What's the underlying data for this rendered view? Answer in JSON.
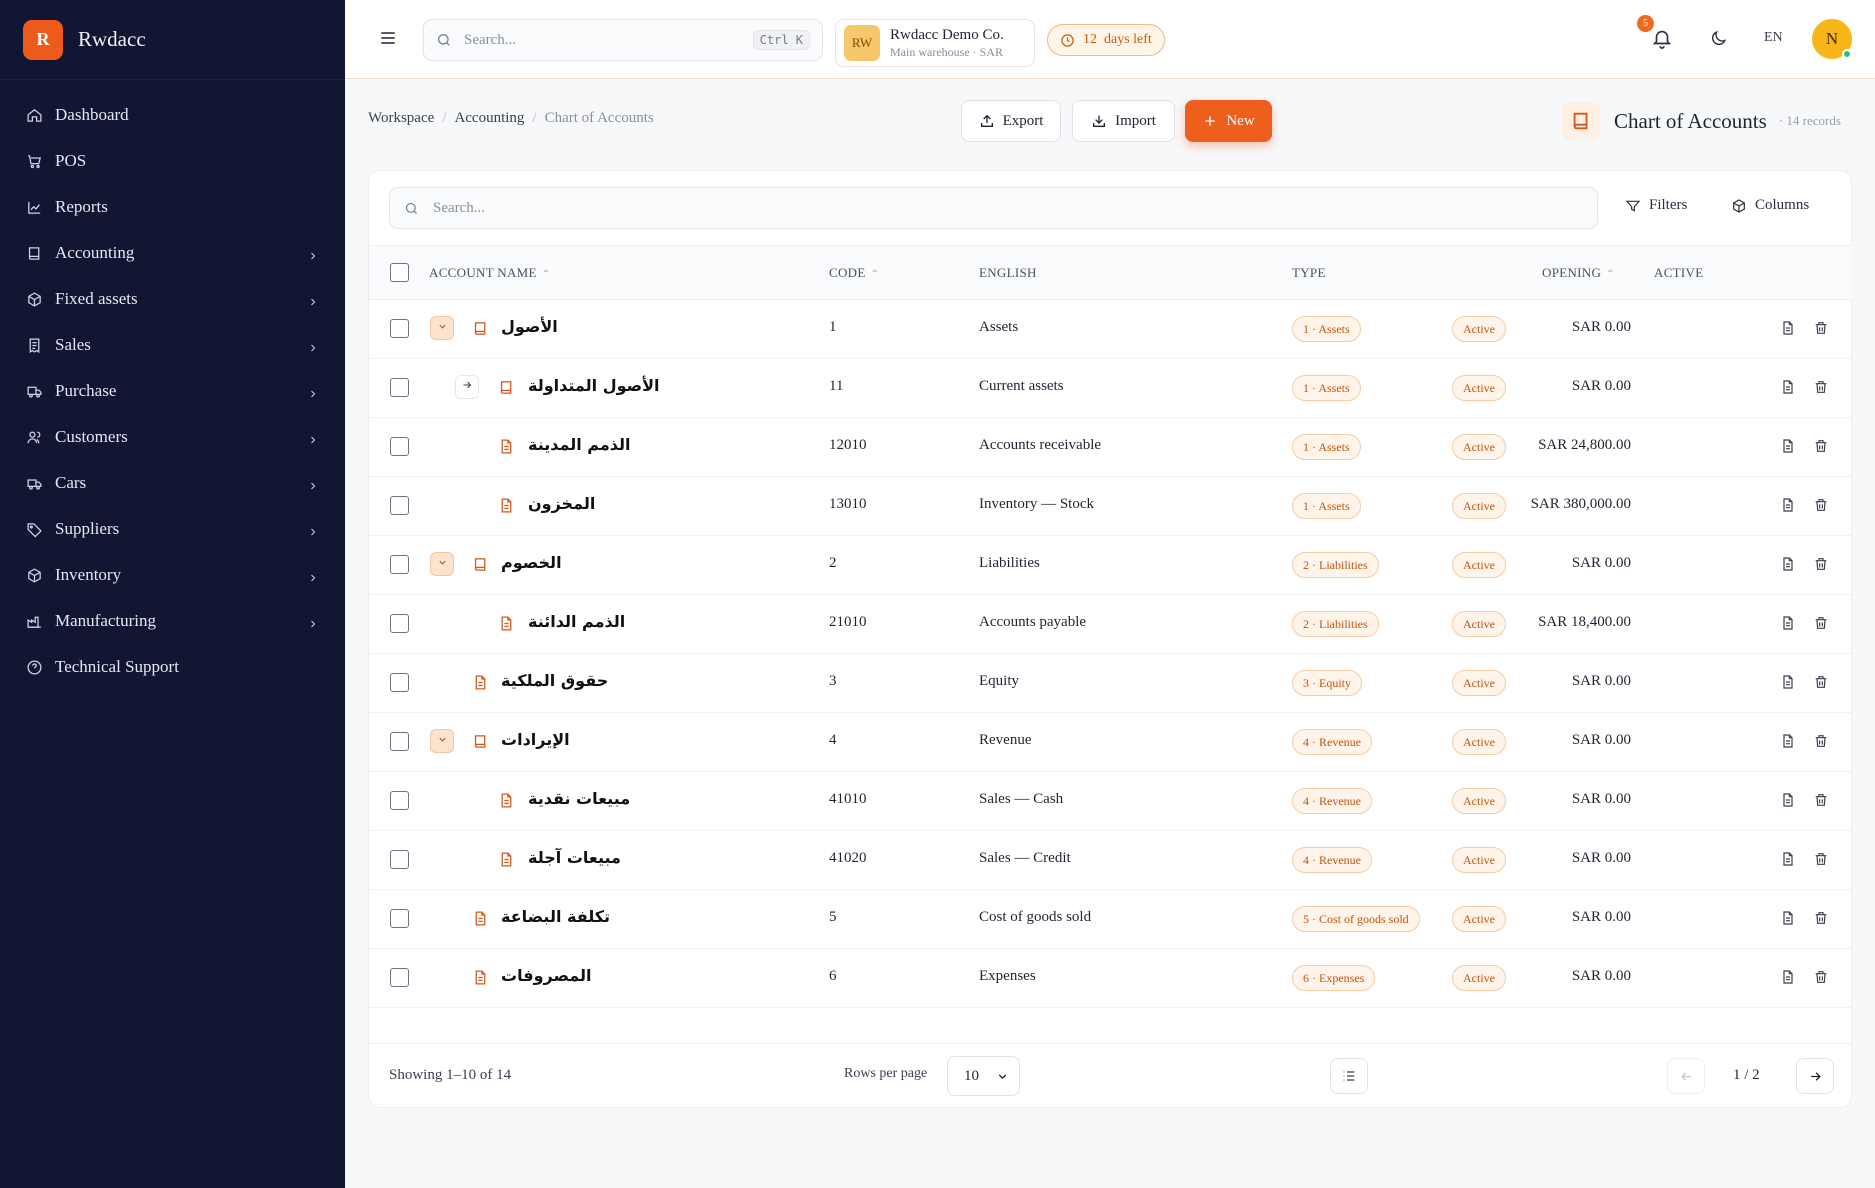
{
  "brand": {
    "logo_letter": "R",
    "name": "Rwdacc"
  },
  "sidebar": {
    "items": [
      {
        "label": "Dashboard",
        "icon": "home-icon",
        "has_children": false
      },
      {
        "label": "POS",
        "icon": "cart-icon",
        "has_children": false
      },
      {
        "label": "Reports",
        "icon": "chart-line-icon",
        "has_children": false
      },
      {
        "label": "Accounting",
        "icon": "book-icon",
        "has_children": true
      },
      {
        "label": "Fixed assets",
        "icon": "box-icon",
        "has_children": true
      },
      {
        "label": "Sales",
        "icon": "receipt-icon",
        "has_children": true
      },
      {
        "label": "Purchase",
        "icon": "truck-icon",
        "has_children": true
      },
      {
        "label": "Customers",
        "icon": "users-icon",
        "has_children": true
      },
      {
        "label": "Cars",
        "icon": "car-icon",
        "has_children": true
      },
      {
        "label": "Suppliers",
        "icon": "tag-icon",
        "has_children": true
      },
      {
        "label": "Inventory",
        "icon": "package-icon",
        "has_children": true
      },
      {
        "label": "Manufacturing",
        "icon": "factory-icon",
        "has_children": true
      },
      {
        "label": "Technical Support",
        "icon": "help-circle-icon",
        "has_children": false
      }
    ]
  },
  "topbar": {
    "search_placeholder": "Search...",
    "search_shortcut": "Ctrl K",
    "company": {
      "initials": "RW",
      "name": "Rwdacc Demo Co.",
      "subtitle": "Main warehouse · SAR"
    },
    "trial": {
      "count": "12",
      "text": "days left"
    },
    "notifications_count": "5",
    "language": "EN",
    "user_initial": "N"
  },
  "breadcrumb": {
    "items": [
      "Workspace",
      "Accounting"
    ],
    "current": "Chart of Accounts"
  },
  "actions": {
    "export_label": "Export",
    "import_label": "Import",
    "new_label": "New"
  },
  "page": {
    "title": "Chart of Accounts",
    "records": "· 14 records"
  },
  "table": {
    "search_placeholder": "Search...",
    "filters_label": "Filters",
    "columns_label": "Columns",
    "headers": {
      "account_name": "ACCOUNT NAME",
      "code": "CODE",
      "english": "ENGLISH",
      "type": "TYPE",
      "opening": "OPENING",
      "active": "ACTIVE"
    },
    "rows": [
      {
        "name": "الأصول",
        "code": "1",
        "english": "Assets",
        "type": "1 · Assets",
        "opening": "SAR 0.00",
        "status": "Active",
        "level": 0,
        "expander": "collapse",
        "icon": "book"
      },
      {
        "name": "الأصول المتداولة",
        "code": "11",
        "english": "Current assets",
        "type": "1 · Assets",
        "opening": "SAR 0.00",
        "status": "Active",
        "level": 1,
        "expander": "arrow",
        "icon": "book"
      },
      {
        "name": "الذمم المدينة",
        "code": "12010",
        "english": "Accounts receivable",
        "type": "1 · Assets",
        "opening": "SAR 24,800.00",
        "status": "Active",
        "level": 2,
        "expander": "",
        "icon": "file"
      },
      {
        "name": "المخزون",
        "code": "13010",
        "english": "Inventory — Stock",
        "type": "1 · Assets",
        "opening": "SAR 380,000.00",
        "status": "Active",
        "level": 2,
        "expander": "",
        "icon": "file"
      },
      {
        "name": "الخصوم",
        "code": "2",
        "english": "Liabilities",
        "type": "2 · Liabilities",
        "opening": "SAR 0.00",
        "status": "Active",
        "level": 0,
        "expander": "collapse",
        "icon": "book"
      },
      {
        "name": "الذمم الدائنة",
        "code": "21010",
        "english": "Accounts payable",
        "type": "2 · Liabilities",
        "opening": "SAR 18,400.00",
        "status": "Active",
        "level": 2,
        "expander": "",
        "icon": "file"
      },
      {
        "name": "حقوق الملكية",
        "code": "3",
        "english": "Equity",
        "type": "3 · Equity",
        "opening": "SAR 0.00",
        "status": "Active",
        "level": 1,
        "expander": "",
        "icon": "file"
      },
      {
        "name": "الإيرادات",
        "code": "4",
        "english": "Revenue",
        "type": "4 · Revenue",
        "opening": "SAR 0.00",
        "status": "Active",
        "level": 0,
        "expander": "collapse",
        "icon": "book"
      },
      {
        "name": "مبيعات نقدية",
        "code": "41010",
        "english": "Sales — Cash",
        "type": "4 · Revenue",
        "opening": "SAR 0.00",
        "status": "Active",
        "level": 2,
        "expander": "",
        "icon": "file"
      },
      {
        "name": "مبيعات آجلة",
        "code": "41020",
        "english": "Sales — Credit",
        "type": "4 · Revenue",
        "opening": "SAR 0.00",
        "status": "Active",
        "level": 2,
        "expander": "",
        "icon": "file"
      },
      {
        "name": "تكلفة البضاعة",
        "code": "5",
        "english": "Cost of goods sold",
        "type": "5 · Cost of goods sold",
        "opening": "SAR 0.00",
        "status": "Active",
        "level": 1,
        "expander": "",
        "icon": "file"
      },
      {
        "name": "المصروفات",
        "code": "6",
        "english": "Expenses",
        "type": "6 · Expenses",
        "opening": "SAR 0.00",
        "status": "Active",
        "level": 1,
        "expander": "",
        "icon": "file"
      }
    ]
  },
  "footer": {
    "showing": "Showing 1–10 of 14",
    "rows_per_page_label": "Rows per page",
    "rows_per_page_value": "10",
    "page_info": "1 / 2"
  },
  "colors": {
    "accent": "#ee5f1e",
    "sidebar_bg": "#111633"
  }
}
